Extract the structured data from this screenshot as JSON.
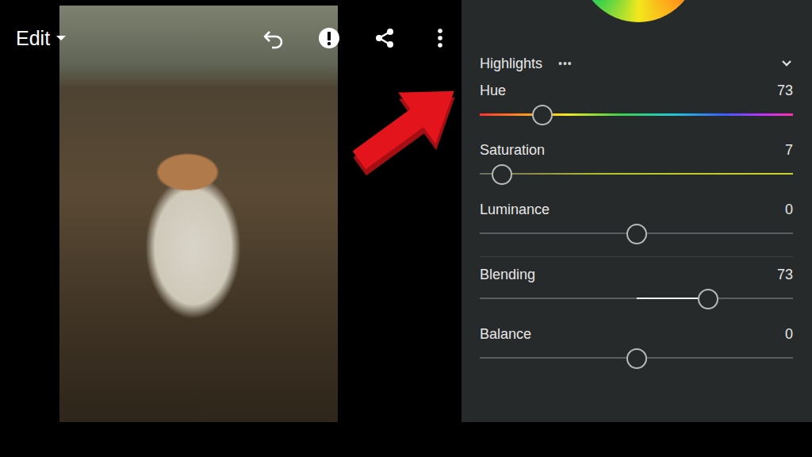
{
  "toolbar": {
    "title": "Edit"
  },
  "panel": {
    "section": "Highlights",
    "more": "•••",
    "expanded": true,
    "sliders": [
      {
        "label": "Hue",
        "value": "73",
        "level": 0.2,
        "kind": "hue"
      },
      {
        "label": "Saturation",
        "value": "7",
        "level": 0.07,
        "kind": "saturation"
      },
      {
        "label": "Luminance",
        "value": "0",
        "level": 0.5,
        "kind": "plain"
      },
      {
        "label": "Blending",
        "value": "73",
        "level": 0.73,
        "kind": "centered"
      },
      {
        "label": "Balance",
        "value": "0",
        "level": 0.5,
        "kind": "plain"
      }
    ]
  }
}
